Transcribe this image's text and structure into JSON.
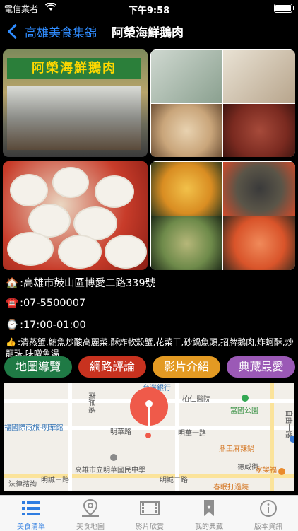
{
  "status_bar": {
    "carrier": "電信業者",
    "time": "下午9:58"
  },
  "nav": {
    "back_label": "高雄美食集錦",
    "title": "阿榮海鮮鵝肉"
  },
  "photos": {
    "storefront_sign": "阿榮海鮮鵝肉"
  },
  "info": {
    "address": ":高雄市鼓山區博愛二路339號",
    "phone": ":07-5500007",
    "hours": ":17:00-01:00",
    "dishes": ":清蒸蟹,鮪魚炒酸高麗菜,酥炸軟殼蟹,花菜干,砂鍋魚頭,招牌鵝肉,炸蚵酥,炒龍珠,味噌魚湯"
  },
  "actions": {
    "map_nav": "地圖導覽",
    "reviews": "網路評論",
    "video": "影片介紹",
    "favorite": "典藏最愛"
  },
  "map": {
    "labels": {
      "hospital": "柏仁醫院",
      "park": "富國公園",
      "hotel": "福國際商旅-明華館",
      "road_minghua": "明華路",
      "road_minghua_1": "明華一路",
      "road_mingcheng_3": "明誠三路",
      "road_mingcheng_2": "明誠二路",
      "road_ziyou_1": "自由一路",
      "road_jiachang": "嘉昌路",
      "road_huazhong": "華中路",
      "road_nanping": "南屏路",
      "restaurant": "鼎王麻辣鍋",
      "school": "高雄市立明華國民中學",
      "building": "德威街",
      "shop": "春眠打過燒",
      "farm": "家樂福",
      "court": "法律諮詢",
      "top_poi": "台灣銀行"
    }
  },
  "tabs": [
    {
      "label": "美食清單",
      "icon": "list-icon",
      "active": true
    },
    {
      "label": "美食地圖",
      "icon": "map-pin-icon",
      "active": false
    },
    {
      "label": "影片欣賞",
      "icon": "film-icon",
      "active": false
    },
    {
      "label": "我的典藏",
      "icon": "bookmark-heart-icon",
      "active": false
    },
    {
      "label": "版本資訊",
      "icon": "info-icon",
      "active": false
    }
  ],
  "colors": {
    "accent_blue": "#2f8cff",
    "pill_green": "#1f7a45",
    "pill_red": "#c8321f",
    "pill_orange": "#e39a23",
    "pill_purple": "#9b59b6",
    "pin_red": "#ef5a4a"
  }
}
